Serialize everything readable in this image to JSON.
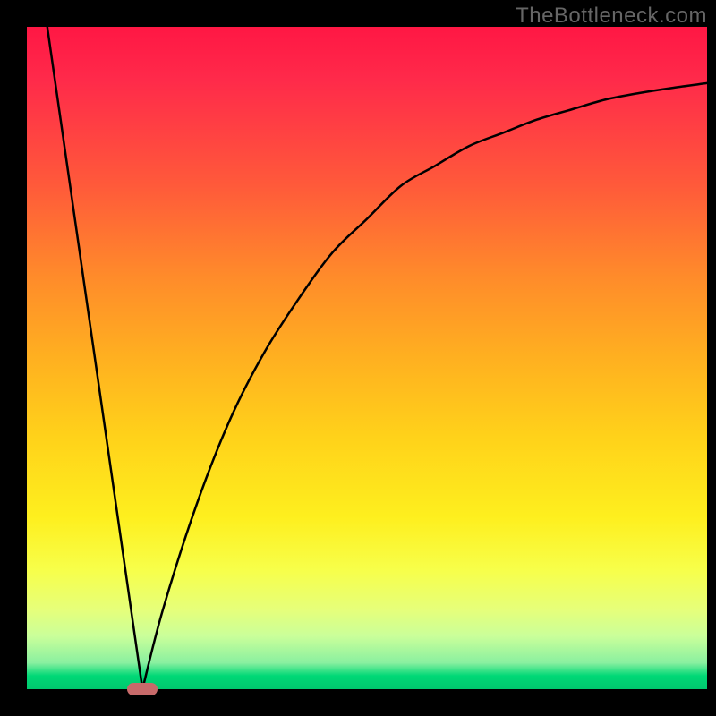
{
  "watermark": "TheBottleneck.com",
  "chart_data": {
    "type": "line",
    "title": "",
    "xlabel": "",
    "ylabel": "",
    "xlim": [
      0,
      100
    ],
    "ylim": [
      0,
      100
    ],
    "series": [
      {
        "name": "left-line",
        "x": [
          3,
          17
        ],
        "y": [
          100,
          0
        ]
      },
      {
        "name": "right-curve",
        "x": [
          17,
          20,
          25,
          30,
          35,
          40,
          45,
          50,
          55,
          60,
          65,
          70,
          75,
          80,
          85,
          90,
          95,
          100
        ],
        "y": [
          0,
          12,
          28,
          41,
          51,
          59,
          66,
          71,
          76,
          79,
          82,
          84,
          86,
          87.5,
          89,
          90,
          90.8,
          91.5
        ]
      }
    ],
    "marker": {
      "x": 17,
      "y": 0,
      "color": "#c76a6a"
    },
    "background": {
      "type": "vertical-gradient",
      "stops": [
        {
          "pos": 0,
          "color": "#ff1744"
        },
        {
          "pos": 50,
          "color": "#ffb020"
        },
        {
          "pos": 82,
          "color": "#f7ff4a"
        },
        {
          "pos": 100,
          "color": "#00c86e"
        }
      ]
    }
  }
}
